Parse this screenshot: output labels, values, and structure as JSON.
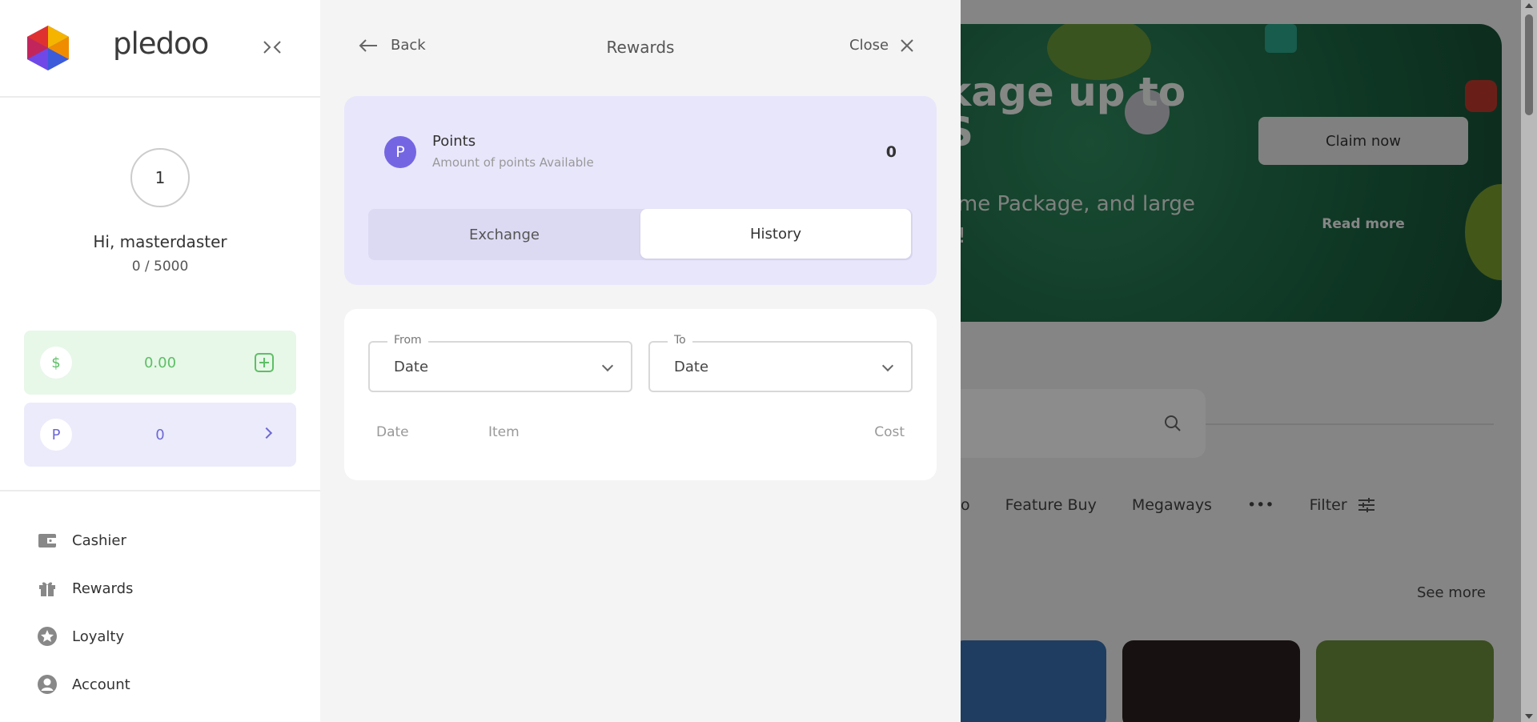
{
  "background": {
    "banner": {
      "title": "kage up to\nS",
      "subtitle": "ome Package, and large\np!",
      "claim_label": "Claim now",
      "read_more_label": "Read more"
    },
    "categories": [
      "no",
      "Feature Buy",
      "Megaways",
      "•••",
      "Filter"
    ],
    "see_more_label": "See more"
  },
  "sidebar": {
    "brand": "pledoo",
    "level": "1",
    "greeting": "Hi, masterdaster",
    "progress": "0 /  5000",
    "cash_symbol": "$",
    "cash_balance": "0.00",
    "points_symbol": "P",
    "points_balance": "0",
    "nav": [
      {
        "label": "Cashier",
        "icon": "wallet-icon"
      },
      {
        "label": "Rewards",
        "icon": "gift-icon"
      },
      {
        "label": "Loyalty",
        "icon": "star-icon"
      },
      {
        "label": "Account",
        "icon": "user-icon"
      }
    ]
  },
  "panel": {
    "back_label": "Back",
    "title": "Rewards",
    "close_label": "Close",
    "points": {
      "symbol": "P",
      "title": "Points",
      "subtitle": "Amount of points Available",
      "value": "0"
    },
    "tabs": [
      {
        "label": "Exchange",
        "active": false
      },
      {
        "label": "History",
        "active": true
      }
    ],
    "from": {
      "legend": "From",
      "value": "Date"
    },
    "to": {
      "legend": "To",
      "value": "Date"
    },
    "columns": [
      "Date",
      "Item",
      "Cost"
    ]
  },
  "colors": {
    "accent_purple": "#7466e3",
    "cash_green": "#5dbf65",
    "banner_green": "#1c6543"
  }
}
